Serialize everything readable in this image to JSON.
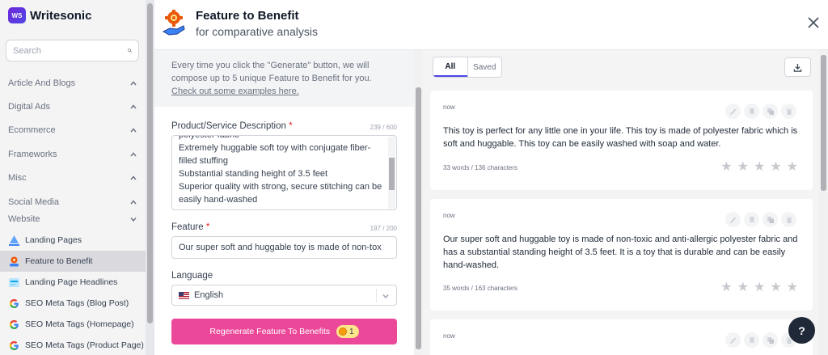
{
  "brand": {
    "badge": "WS",
    "name": "Writesonic"
  },
  "sidebar": {
    "search_placeholder": "Search",
    "categories": [
      "Article And Blogs",
      "Digital Ads",
      "Ecommerce",
      "Frameworks",
      "Misc",
      "Social Media",
      "Website"
    ],
    "items": [
      "Landing Pages",
      "Feature to Benefit",
      "Landing Page Headlines",
      "SEO Meta Tags (Blog Post)",
      "SEO Meta Tags (Homepage)",
      "SEO Meta Tags (Product Page)"
    ]
  },
  "header": {
    "title": "Feature to Benefit",
    "subtitle": "for comparative analysis"
  },
  "form": {
    "info_text": "Every time you click the \"Generate\" button, we will compose up to 5 unique Feature to Benefit for you.",
    "info_link": "Check out some examples here.",
    "description_label": "Product/Service Description",
    "description_counter": "239 / 600",
    "description_value": "polyester fabric\nExtremely huggable soft toy with conjugate fiber-filled stuffing\nSubstantial standing height of 3.5 feet\nSuperior quality with strong, secure stitching can be easily hand-washed",
    "feature_label": "Feature",
    "feature_counter": "197 / 200",
    "feature_value": "Our super soft and huggable toy is made of non-tox",
    "language_label": "Language",
    "language_value": "English",
    "generate_label": "Regenerate Feature To Benefits",
    "credits": "1"
  },
  "results": {
    "tabs": [
      "All",
      "Saved"
    ],
    "cards": [
      {
        "time": "now",
        "text": "This toy is perfect for any little one in your life. This toy is made of polyester fabric which is soft and huggable. This toy can be easily washed with soap and water.",
        "meta": "33 words / 136 characters",
        "rating": 0
      },
      {
        "time": "now",
        "text": "Our super soft and huggable toy is made of non-toxic and anti-allergic polyester fabric and has a substantial standing height of 3.5 feet. It is a toy that is durable and can be easily hand-washed.",
        "meta": "35 words / 163 characters",
        "rating": 0
      },
      {
        "time": "now"
      }
    ]
  },
  "help_label": "?"
}
